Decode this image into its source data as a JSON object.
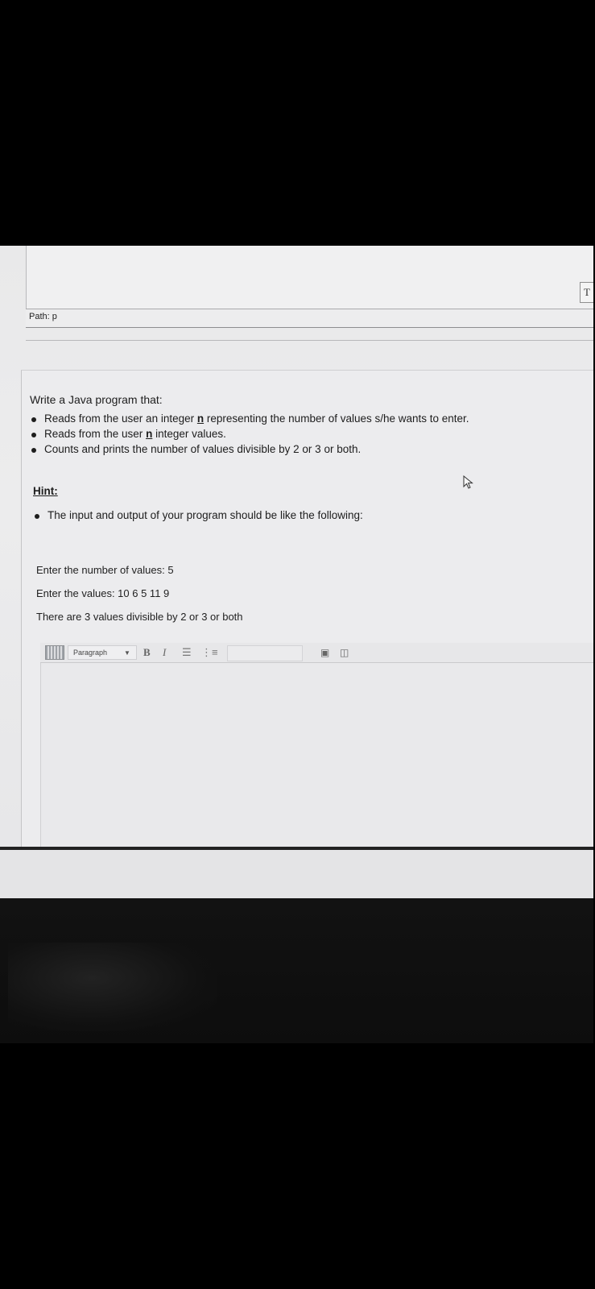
{
  "status_bar": {
    "path": "Path: p"
  },
  "right_button": {
    "label": "T"
  },
  "question": {
    "title": "Write a Java program that:",
    "bullets": [
      {
        "pre": "Reads from the user an integer ",
        "bold": "n",
        "post": " representing the number of values s/he wants to enter."
      },
      {
        "pre": "Reads from the user ",
        "bold": "n",
        "post": " integer values."
      },
      {
        "text": "Counts and prints the number of values divisible by 2 or 3 or both."
      }
    ],
    "hint_title": "Hint:",
    "hint_item": "The input and output of your program should be like the following:",
    "sample": [
      "Enter the number of values: 5",
      "Enter the values: 10 6 5 11 9",
      "There are 3 values divisible by 2 or 3 or both"
    ]
  },
  "editor": {
    "format_select": "Paragraph",
    "bold_label": "B",
    "italic_label": "I",
    "icons": [
      "table-icon",
      "chevron-down-icon",
      "bullet-list-icon",
      "numbered-list-icon",
      "image-icon",
      "media-icon",
      "cursor-icon"
    ]
  }
}
